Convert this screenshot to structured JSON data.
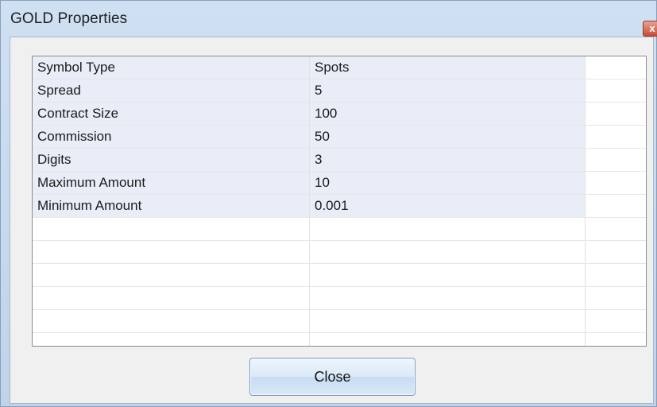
{
  "window": {
    "title": "GOLD Properties",
    "close_glyph": "x"
  },
  "properties": [
    {
      "name": "Symbol Type",
      "value": "Spots"
    },
    {
      "name": "Spread",
      "value": "5"
    },
    {
      "name": "Contract Size",
      "value": "100"
    },
    {
      "name": "Commission",
      "value": "50"
    },
    {
      "name": "Digits",
      "value": "3"
    },
    {
      "name": "Maximum Amount",
      "value": "10"
    },
    {
      "name": "Minimum Amount",
      "value": "0.001"
    }
  ],
  "footer": {
    "close_label": "Close"
  },
  "colors": {
    "row_fill": "#e8edf7",
    "titlebar": "#cfe0f3",
    "close_x": "#c84a34"
  }
}
